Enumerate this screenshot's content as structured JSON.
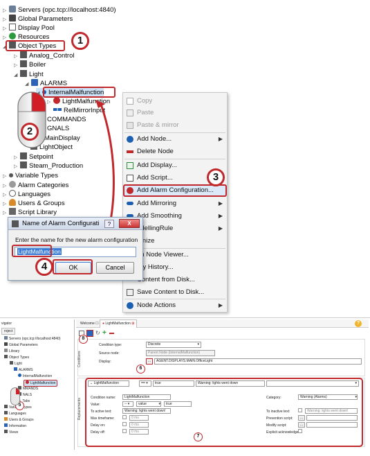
{
  "tree": {
    "items": [
      {
        "label": "Servers (opc.tcp://localhost:4840)"
      },
      {
        "label": "Global Parameters"
      },
      {
        "label": "Display Pool"
      },
      {
        "label": "Resources"
      },
      {
        "label": "Object Types"
      },
      {
        "label": "Analog_Control"
      },
      {
        "label": "Boiler"
      },
      {
        "label": "Light"
      },
      {
        "label": "ALARMS"
      },
      {
        "label": "InternalMalfunction"
      },
      {
        "label": "LightMalfunction"
      },
      {
        "label": "RelMirrorInput"
      },
      {
        "label": "COMMANDS"
      },
      {
        "label": "GNALS"
      },
      {
        "label": "MainDisplay"
      },
      {
        "label": "LightObject"
      },
      {
        "label": "Setpoint"
      },
      {
        "label": "Steam_Production"
      },
      {
        "label": "Variable Types"
      },
      {
        "label": "Alarm Categories"
      },
      {
        "label": "Languages"
      },
      {
        "label": "Users & Groups"
      },
      {
        "label": "Script Library"
      }
    ]
  },
  "context_menu": {
    "items": [
      {
        "label": "Copy"
      },
      {
        "label": "Paste"
      },
      {
        "label": "Paste & mirror"
      },
      {
        "label": "Add Node..."
      },
      {
        "label": "Delete Node"
      },
      {
        "label": "Add Display..."
      },
      {
        "label": "Add Script..."
      },
      {
        "label": "Add Alarm Configuration..."
      },
      {
        "label": "Add Mirroring"
      },
      {
        "label": "Add Smoothing"
      },
      {
        "label": "odellingRule"
      },
      {
        "label": "tonize"
      },
      {
        "label": "en Node Viewer..."
      },
      {
        "label": "ery History..."
      },
      {
        "label": "Content from Disk..."
      },
      {
        "label": "Save Content to Disk..."
      },
      {
        "label": "Node Actions"
      }
    ]
  },
  "dialog": {
    "title": "Name of Alarm Configurati",
    "question_mark": "?",
    "close": "X",
    "prompt": "Enter the name for the new alarm configuration",
    "value": "LightMalfunction",
    "ok": "OK",
    "cancel": "Cancel"
  },
  "badges": {
    "b1": "1",
    "b2": "2",
    "b3": "3",
    "b4": "4",
    "b5": "5",
    "b6": "6",
    "b7": "7",
    "b8": "8"
  },
  "bottom": {
    "navigator_title": "vigator",
    "project_tab": "roject",
    "nav_items": [
      {
        "label": "Servers (opc.tcp://localhost:4840)"
      },
      {
        "label": "Global Parameters"
      },
      {
        "label": "Library"
      },
      {
        "label": "Object Types"
      },
      {
        "label": "Light"
      },
      {
        "label": "ALARMS"
      },
      {
        "label": "InternalMalfunction"
      },
      {
        "label": "LightMalfunction"
      },
      {
        "label": "MMANDS"
      },
      {
        "label": "NALS"
      },
      {
        "label": "e_Tabs"
      },
      {
        "label": "Variable Types"
      },
      {
        "label": "Languages"
      },
      {
        "label": "Users & Groups"
      },
      {
        "label": "Information"
      },
      {
        "label": "Views"
      }
    ],
    "tab_welcome": "Welcome",
    "tab_alarm": "LightMalfunction",
    "help": "?",
    "conditions_label": "Conditions",
    "condition_type_label": "Condition type:",
    "condition_type_value": "Discrete",
    "source_node_label": "Source node:",
    "source_node_value": "Parent Node (InternalMalfunction)",
    "display_label": "Display:",
    "display_value": "AGENT.DISPLAYS.MAIN.OfficeLight",
    "ellipsis": "...",
    "replacements_label": "Replacements",
    "row_name": "LightMalfunction",
    "row_op": "==",
    "row_value": "true",
    "row_text": "Warning: lights went down",
    "condition_name_label": "Condition name:",
    "condition_name_value": "LightMalfunction",
    "value_label": "Value:",
    "value_op": "--",
    "value_kind": "value",
    "value_value": "true",
    "to_active_label": "To active text:",
    "to_active_value": "Warning: lights went down!",
    "max_timeframe_label": "Max timeframe:",
    "delay_on_label": "Delay on:",
    "delay_off_label": "Delay off:",
    "zero_s": "0 ms",
    "category_label": "Category:",
    "category_value": "Warning (Alarms)",
    "to_inactive_label": "To inactive text:",
    "to_inactive_value": "Warning: lights went down!",
    "prevention_label": "Prevention script:",
    "modify_label": "Modify script:",
    "explicit_label": "Explicit acknowledge:"
  },
  "colors": {
    "accent": "#c0282c",
    "selection": "#cde3f7",
    "link": "#1d5fb0"
  }
}
